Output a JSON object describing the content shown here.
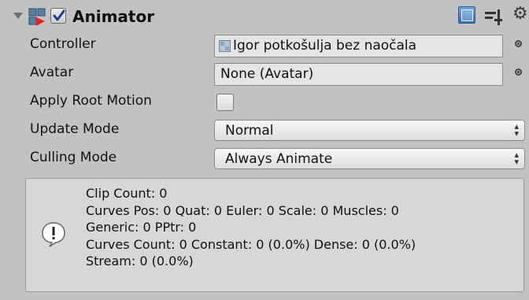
{
  "component": {
    "title": "Animator",
    "enabled": true,
    "icons": [
      "foldout-arrow-icon",
      "animator-icon",
      "help-icon",
      "preset-icon",
      "gear-icon"
    ]
  },
  "fields": {
    "controller": {
      "label": "Controller",
      "value": "Igor potkošulja bez naočala"
    },
    "avatar": {
      "label": "Avatar",
      "value": "None (Avatar)"
    },
    "apply_root_motion": {
      "label": "Apply Root Motion",
      "checked": false
    },
    "update_mode": {
      "label": "Update Mode",
      "value": "Normal"
    },
    "culling_mode": {
      "label": "Culling Mode",
      "value": "Always Animate"
    }
  },
  "info": {
    "lines": [
      "Clip Count: 0",
      "Curves Pos: 0 Quat: 0 Euler: 0 Scale: 0 Muscles: 0",
      "Generic: 0 PPtr: 0",
      "Curves Count: 0 Constant: 0 (0.0%) Dense: 0 (0.0%)",
      "Stream: 0 (0.0%)"
    ]
  },
  "colors": {
    "background": "#c2c2c2",
    "field": "#e4e4e4",
    "help_icon": "#3b7cc4"
  }
}
